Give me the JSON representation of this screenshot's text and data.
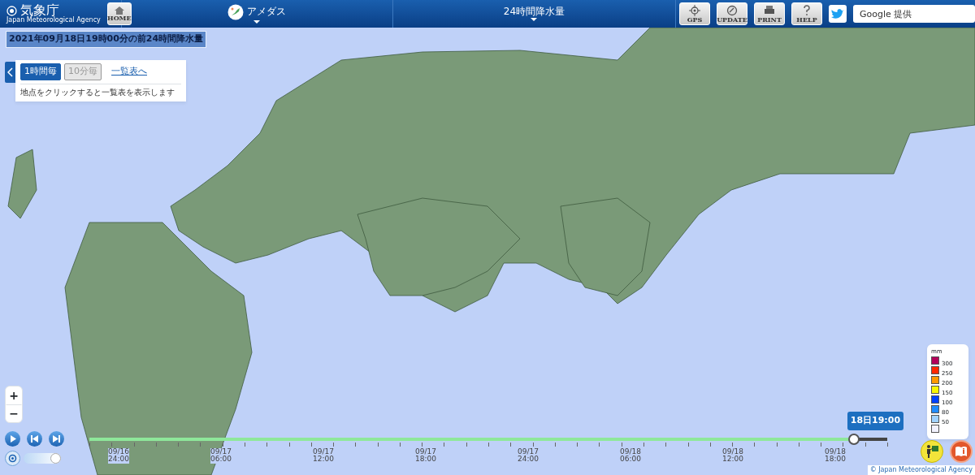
{
  "header": {
    "logo_title": "気象庁",
    "logo_subtitle": "Japan Meteorological Agency",
    "home_label": "HOME",
    "product_menu": "アメダス",
    "element_menu": "24時間降水量",
    "tools": [
      {
        "label": "GPS",
        "kind": "gps"
      },
      {
        "label": "UPDATE",
        "kind": "update"
      },
      {
        "label": "PRINT",
        "kind": "print"
      },
      {
        "label": "HELP",
        "kind": "help"
      }
    ],
    "search": {
      "placeholder": "Google 提供"
    }
  },
  "title_chip": "2021年09月18日19時00分の前24時間降水量",
  "panel": {
    "intervals": [
      {
        "label": "1時間毎",
        "selected": true
      },
      {
        "label": "10分毎",
        "selected": false
      }
    ],
    "list_link": "一覧表へ",
    "hint": "地点をクリックすると一覧表を表示します"
  },
  "zoom": [
    "+",
    "−"
  ],
  "speed": {
    "level": 1.0
  },
  "timeline": {
    "tooltip": "18日19:00",
    "level": 0.958,
    "ticks": [
      {
        "date": "09/16",
        "time": "24:00"
      },
      {
        "date": "09/17",
        "time": "06:00"
      },
      {
        "date": "09/17",
        "time": "12:00"
      },
      {
        "date": "09/17",
        "time": "18:00"
      },
      {
        "date": "09/17",
        "time": "24:00"
      },
      {
        "date": "09/18",
        "time": "06:00"
      },
      {
        "date": "09/18",
        "time": "12:00"
      },
      {
        "date": "09/18",
        "time": "18:00"
      }
    ]
  },
  "legend": {
    "unit": "mm",
    "items": [
      {
        "color": "#b4005a",
        "label": "300"
      },
      {
        "color": "#ff2800",
        "label": "250"
      },
      {
        "color": "#ff9900",
        "label": "200"
      },
      {
        "color": "#faf500",
        "label": "150"
      },
      {
        "color": "#0041ff",
        "label": "100"
      },
      {
        "color": "#218cff",
        "label": "80"
      },
      {
        "color": "#a0d2ff",
        "label": "50"
      },
      {
        "color": "#f2f2ff"
      }
    ]
  },
  "copyright": "© Japan Meteorological Agency"
}
